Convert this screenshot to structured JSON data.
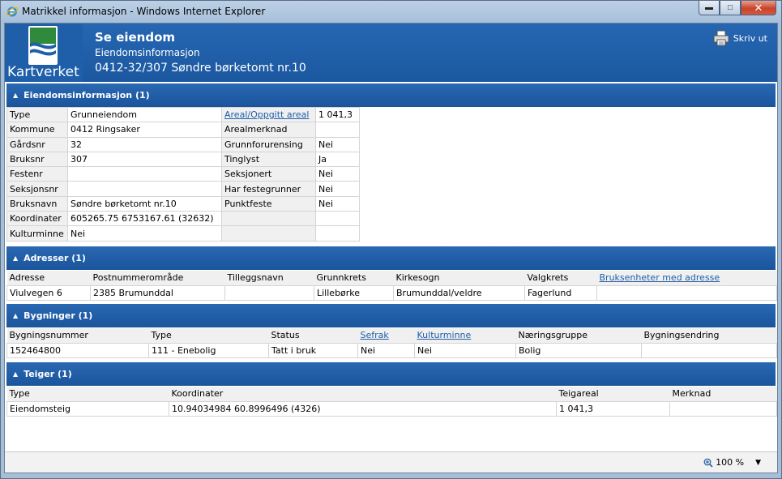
{
  "window": {
    "title": "Matrikkel informasjon - Windows Internet Explorer",
    "buttons": {
      "minimize": "▬",
      "maximize": "□",
      "close": "✕"
    }
  },
  "header": {
    "logo_text": "Kartverket",
    "title": "Se eiendom",
    "subtitle": "Eiendomsinformasjon",
    "property": "0412-32/307 Søndre børketomt nr.10",
    "print_label": "Skriv ut"
  },
  "sections": {
    "eiendom": "Eiendomsinformasjon (1)",
    "adresser": "Adresser (1)",
    "bygninger": "Bygninger (1)",
    "teiger": "Teiger (1)"
  },
  "eiendom": {
    "rows": [
      [
        "Type",
        "Grunneiendom",
        "Areal/Oppgitt areal",
        "1 041,3"
      ],
      [
        "Kommune",
        "0412 Ringsaker",
        "Arealmerknad",
        ""
      ],
      [
        "Gårdsnr",
        "32",
        "Grunnforurensing",
        "Nei"
      ],
      [
        "Bruksnr",
        "307",
        "Tinglyst",
        "Ja"
      ],
      [
        "Festenr",
        "",
        "Seksjonert",
        "Nei"
      ],
      [
        "Seksjonsnr",
        "",
        "Har festegrunner",
        "Nei"
      ],
      [
        "Bruksnavn",
        "Søndre børketomt nr.10",
        "Punktfeste",
        "Nei"
      ],
      [
        "Koordinater",
        "605265.75 6753167.61 (32632)",
        "",
        ""
      ],
      [
        "Kulturminne",
        "Nei",
        "",
        ""
      ]
    ]
  },
  "adresser": {
    "headers": [
      "Adresse",
      "Postnummerområde",
      "Tilleggsnavn",
      "Grunnkrets",
      "Kirkesogn",
      "Valgkrets",
      "Bruksenheter med adresse"
    ],
    "row": [
      "Viulvegen 6",
      "2385 Brumunddal",
      "",
      "Lillebørke",
      "Brumunddal/veldre",
      "Fagerlund",
      ""
    ]
  },
  "bygninger": {
    "headers": [
      "Bygningsnummer",
      "Type",
      "Status",
      "Sefrak",
      "Kulturminne",
      "Næringsgruppe",
      "Bygningsendring"
    ],
    "row": [
      "152464800",
      "111 - Enebolig",
      "Tatt i bruk",
      "Nei",
      "Nei",
      "Bolig",
      ""
    ]
  },
  "teiger": {
    "headers": [
      "Type",
      "Koordinater",
      "Teigareal",
      "Merknad"
    ],
    "row": [
      "Eiendomsteig",
      "10.94034984 60.8996496 (4326)",
      "1 041,3",
      ""
    ]
  },
  "statusbar": {
    "zoom": "100 %"
  },
  "colors": {
    "brand_blue": "#1f5ea8",
    "link": "#1f5ea8"
  }
}
